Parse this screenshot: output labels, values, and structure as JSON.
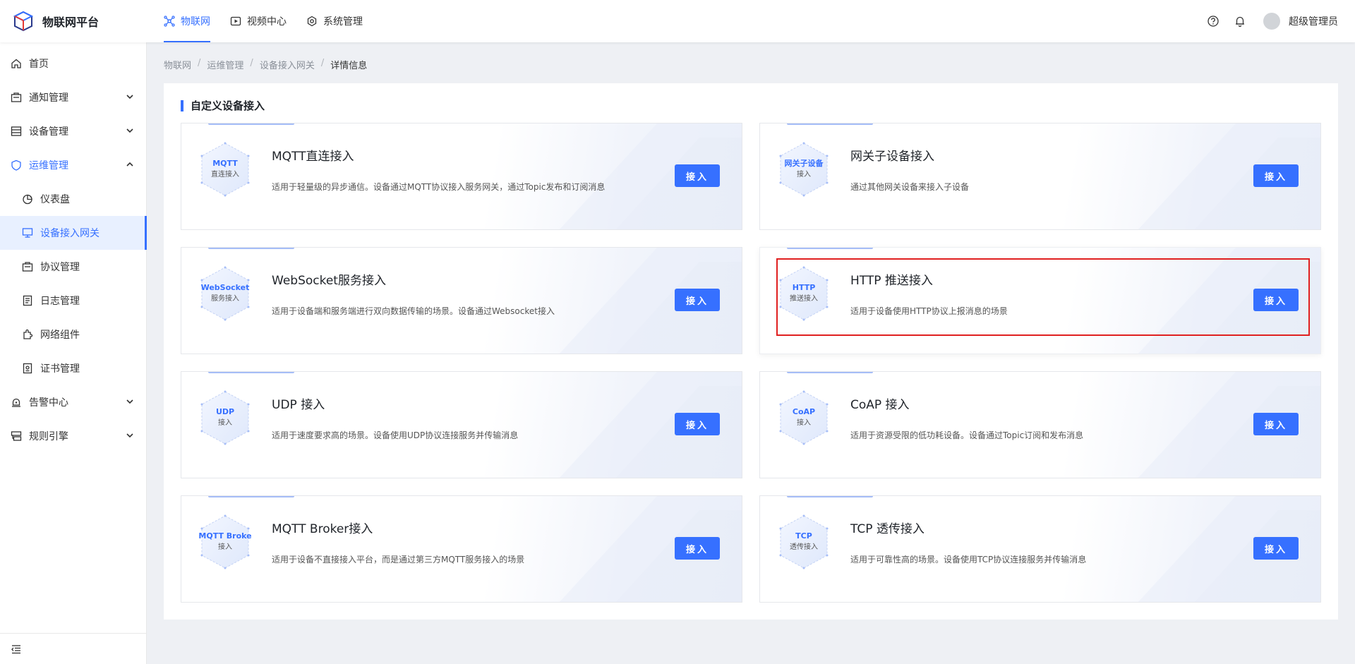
{
  "header": {
    "logo_text": "物联网平台",
    "nav": [
      {
        "label": "物联网",
        "icon": "iot-icon",
        "active": true
      },
      {
        "label": "视频中心",
        "icon": "video-icon",
        "active": false
      },
      {
        "label": "系统管理",
        "icon": "settings-icon",
        "active": false
      }
    ],
    "username": "超级管理员",
    "accent_color": "#3670ff"
  },
  "sidebar": {
    "items": [
      {
        "label": "首页",
        "icon": "home-icon"
      },
      {
        "label": "通知管理",
        "icon": "notification-icon",
        "expandable": true
      },
      {
        "label": "设备管理",
        "icon": "device-icon",
        "expandable": true
      },
      {
        "label": "运维管理",
        "icon": "ops-icon",
        "expandable": true,
        "open": true
      },
      {
        "label": "仪表盘",
        "icon": "dashboard-icon",
        "sub": true
      },
      {
        "label": "设备接入网关",
        "icon": "gateway-icon",
        "sub": true,
        "selected": true
      },
      {
        "label": "协议管理",
        "icon": "protocol-icon",
        "sub": true
      },
      {
        "label": "日志管理",
        "icon": "log-icon",
        "sub": true
      },
      {
        "label": "网络组件",
        "icon": "network-icon",
        "sub": true
      },
      {
        "label": "证书管理",
        "icon": "certificate-icon",
        "sub": true
      },
      {
        "label": "告警中心",
        "icon": "alarm-icon",
        "expandable": true
      },
      {
        "label": "规则引擎",
        "icon": "rule-icon",
        "expandable": true
      }
    ]
  },
  "breadcrumb": [
    "物联网",
    "运维管理",
    "设备接入网关",
    "详情信息"
  ],
  "section_title": "自定义设备接入",
  "cards": [
    {
      "hex_title": "MQTT",
      "hex_sub": "直连接入",
      "title": "MQTT直连接入",
      "desc": "适用于轻量级的异步通信。设备通过MQTT协议接入服务网关，通过Topic发布和订阅消息",
      "button": "接入"
    },
    {
      "hex_title": "网关子设备",
      "hex_sub": "接入",
      "title": "网关子设备接入",
      "desc": "通过其他网关设备来接入子设备",
      "button": "接入"
    },
    {
      "hex_title": "WebSocket",
      "hex_sub": "服务接入",
      "title": "WebSocket服务接入",
      "desc": "适用于设备端和服务端进行双向数据传输的场景。设备通过Websocket接入",
      "button": "接入"
    },
    {
      "hex_title": "HTTP",
      "hex_sub": "推送接入",
      "title": "HTTP 推送接入",
      "desc": "适用于设备使用HTTP协议上报消息的场景",
      "button": "接入"
    },
    {
      "hex_title": "UDP",
      "hex_sub": "接入",
      "title": "UDP 接入",
      "desc": "适用于速度要求高的场景。设备使用UDP协议连接服务并传输消息",
      "button": "接入"
    },
    {
      "hex_title": "CoAP",
      "hex_sub": "接入",
      "title": "CoAP 接入",
      "desc": "适用于资源受限的低功耗设备。设备通过Topic订阅和发布消息",
      "button": "接入"
    },
    {
      "hex_title": "MQTT Broke",
      "hex_sub": "接入",
      "title": "MQTT Broker接入",
      "desc": "适用于设备不直接接入平台，而是通过第三方MQTT服务接入的场景",
      "button": "接入"
    },
    {
      "hex_title": "TCP",
      "hex_sub": "透传接入",
      "title": "TCP 透传接入",
      "desc": "适用于可靠性高的场景。设备使用TCP协议连接服务并传输消息",
      "button": "接入"
    }
  ]
}
